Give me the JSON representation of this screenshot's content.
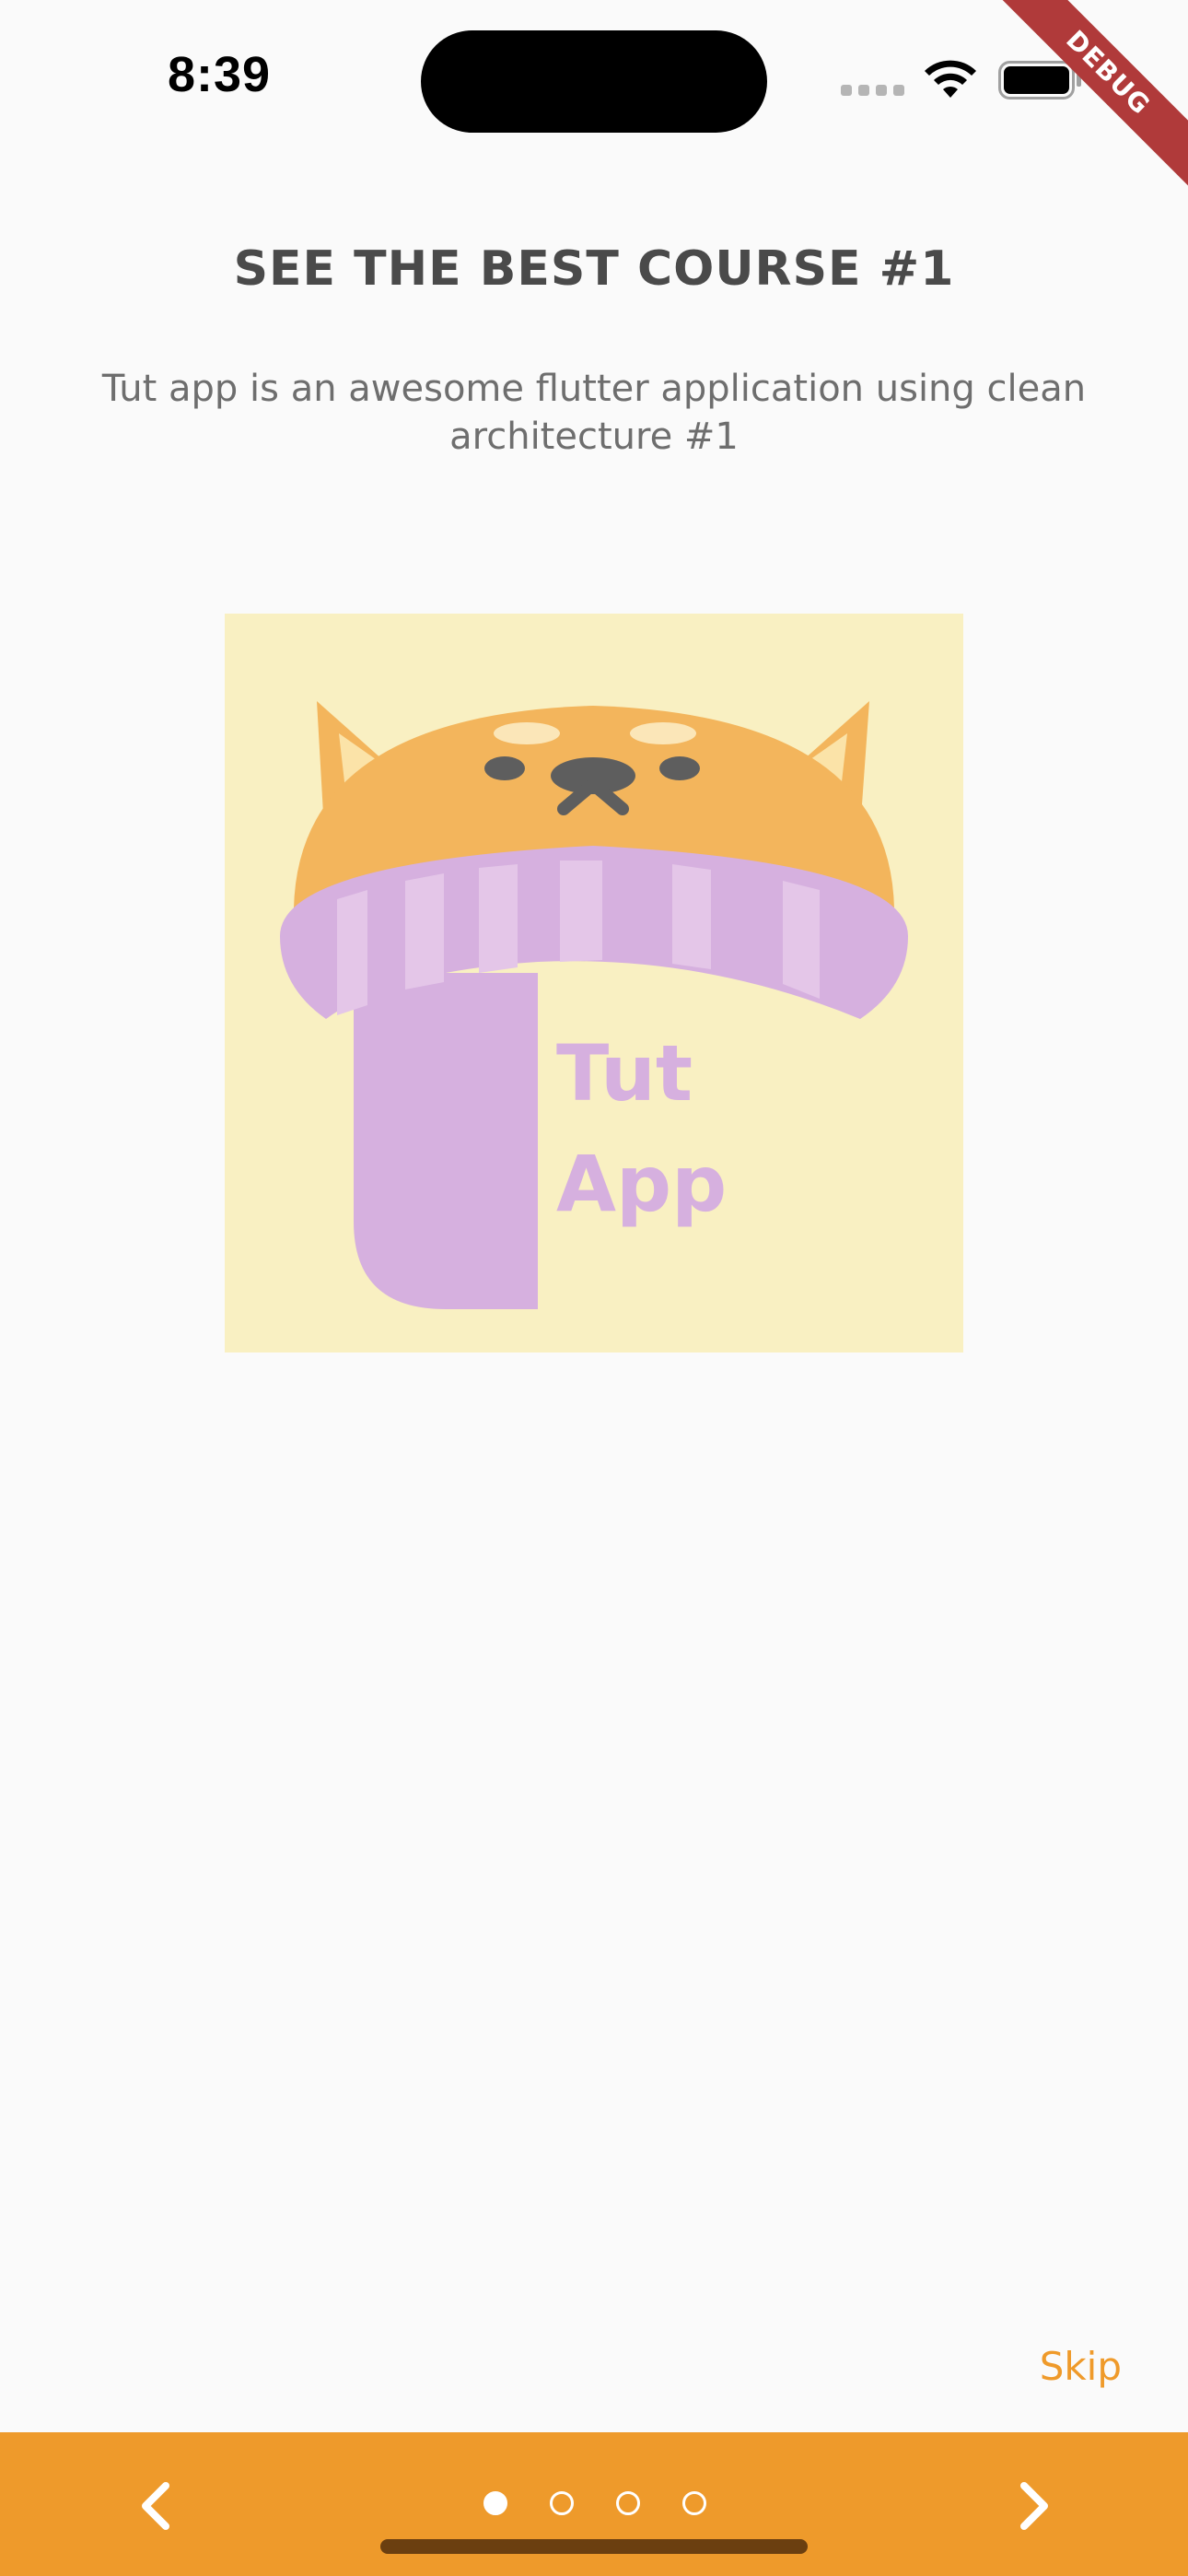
{
  "status_bar": {
    "time": "8:39",
    "icons": [
      "cellular-signal-icon",
      "wifi-icon",
      "battery-icon"
    ]
  },
  "debug_banner": {
    "label": "DEBUG"
  },
  "onboarding": {
    "title": "SEE THE BEST COURSE #1",
    "subtitle": "Tut app is an awesome flutter application using clean architecture #1",
    "illustration": {
      "name": "tut-app-logo",
      "text_line_1": "Tut",
      "text_line_2": "App"
    },
    "skip_label": "Skip"
  },
  "bottom_bar": {
    "back_icon": "chevron-left-icon",
    "next_icon": "chevron-right-icon",
    "page_count": 4,
    "current_page": 1
  },
  "colors": {
    "background": "#fafafa",
    "accent": "#ee9a2b",
    "title_text": "#4a4a4a",
    "body_text": "#6e6e6e",
    "debug_ribbon": "#b03a3a",
    "logo_background": "#f9f0c2",
    "logo_orange": "#f3b55c",
    "logo_purple": "#d6b0df"
  }
}
